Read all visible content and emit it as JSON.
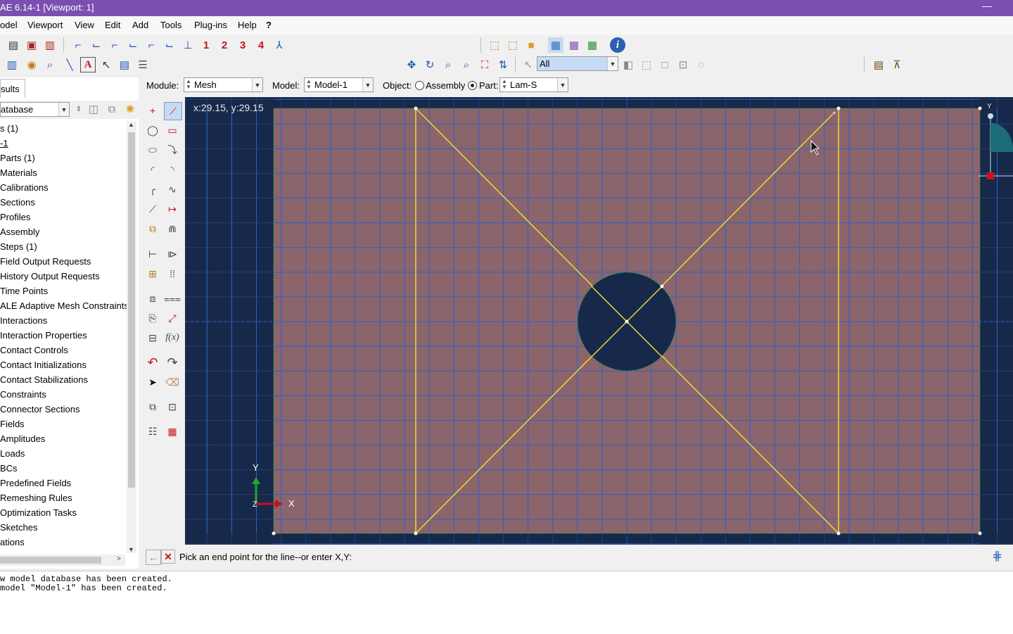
{
  "window": {
    "title": "AE 6.14-1 [Viewport: 1]",
    "minimize_glyph": "—"
  },
  "menu": [
    "odel",
    "Viewport",
    "View",
    "Edit",
    "Add",
    "Tools",
    "Plug-ins",
    "Help",
    "?"
  ],
  "toolbar": {
    "view_numbers": [
      "1",
      "2",
      "3",
      "4"
    ],
    "selection_filter": "All"
  },
  "module_bar": {
    "module_label": "Module:",
    "module_value": "Mesh",
    "model_label": "Model:",
    "model_value": "Model-1",
    "object_label": "Object:",
    "assembly_label": "Assembly",
    "part_label": "Part:",
    "part_value": "Lam-S"
  },
  "left_panel": {
    "tab_label": "sults",
    "database_combo": "atabase",
    "tree_items": [
      "s (1)",
      "-1",
      "Parts (1)",
      "Materials",
      "Calibrations",
      "Sections",
      "Profiles",
      "Assembly",
      "Steps (1)",
      "Field Output Requests",
      "History Output Requests",
      "Time Points",
      "ALE Adaptive Mesh Constraints",
      "Interactions",
      "Interaction Properties",
      "Contact Controls",
      "Contact Initializations",
      "Contact Stabilizations",
      "Constraints",
      "Connector Sections",
      "Fields",
      "Amplitudes",
      "Loads",
      "BCs",
      "Predefined Fields",
      "Remeshing Rules",
      "Optimization Tasks",
      "Sketches",
      "ations"
    ]
  },
  "viewport": {
    "coordinate_readout": "x:29.15, y:29.15",
    "triad": {
      "y_label": "Y",
      "x_label": "X",
      "z_label": "Z"
    },
    "mini_y_label": "Y",
    "colors": {
      "background": "#17294a",
      "plate": "#8b646c",
      "grid": "#2a63c4",
      "sketch": "#f0dc2a",
      "hole": "#17294a"
    }
  },
  "prompt": {
    "text": "Pick an end point for the line--or enter X,Y:"
  },
  "messages": [
    "w model database has been created.",
    "model \"Model-1\" has been created."
  ]
}
